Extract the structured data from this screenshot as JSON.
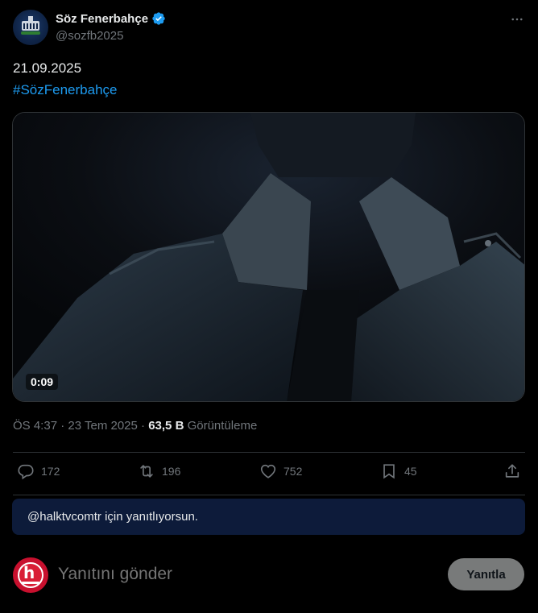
{
  "author": {
    "display_name": "Söz Fenerbahçe",
    "handle": "@sozfb2025",
    "avatar_icon": "club-building-logo",
    "verified_icon": "verified-badge-icon"
  },
  "tweet": {
    "line1": "21.09.2025",
    "hashtag": "#SözFenerbahçe"
  },
  "video": {
    "duration": "0:09"
  },
  "meta": {
    "time": "ÖS 4:37",
    "separator": "·",
    "date": "23 Tem 2025",
    "views_count": "63,5 B",
    "views_label": "Görüntüleme"
  },
  "actions": {
    "replies": "172",
    "reposts": "196",
    "likes": "752",
    "bookmarks": "45"
  },
  "reply": {
    "banner": "@halktvcomtr için yanıtlıyorsun.",
    "placeholder": "Yanıtını gönder",
    "button_label": "Yanıtla"
  },
  "colors": {
    "accent": "#1d9bf0",
    "banner_bg": "#0d1b3a",
    "muted": "#71767b"
  }
}
